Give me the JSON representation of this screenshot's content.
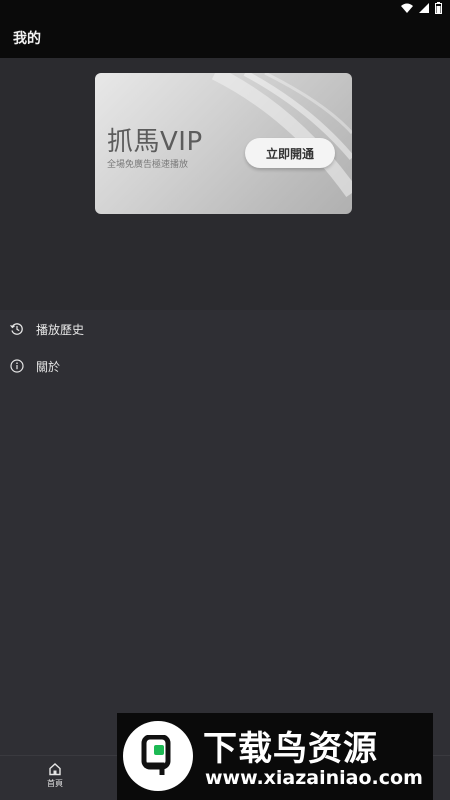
{
  "header": {
    "title": "我的"
  },
  "vip_card": {
    "title": "抓馬VIP",
    "subtitle": "全場免廣告極速播放",
    "button_label": "立即開通"
  },
  "menu": [
    {
      "label": "播放歷史",
      "icon": "history-icon"
    },
    {
      "label": "關於",
      "icon": "info-icon"
    }
  ],
  "bottom_nav": {
    "home_label": "首頁"
  },
  "watermark": {
    "title": "下载鸟资源",
    "url": "www.xiazainiao.com"
  },
  "colors": {
    "background": "#2b2b2f",
    "app_bar": "#0a0a0a",
    "list_background": "#2f2f34",
    "text": "#e6e6e6"
  }
}
